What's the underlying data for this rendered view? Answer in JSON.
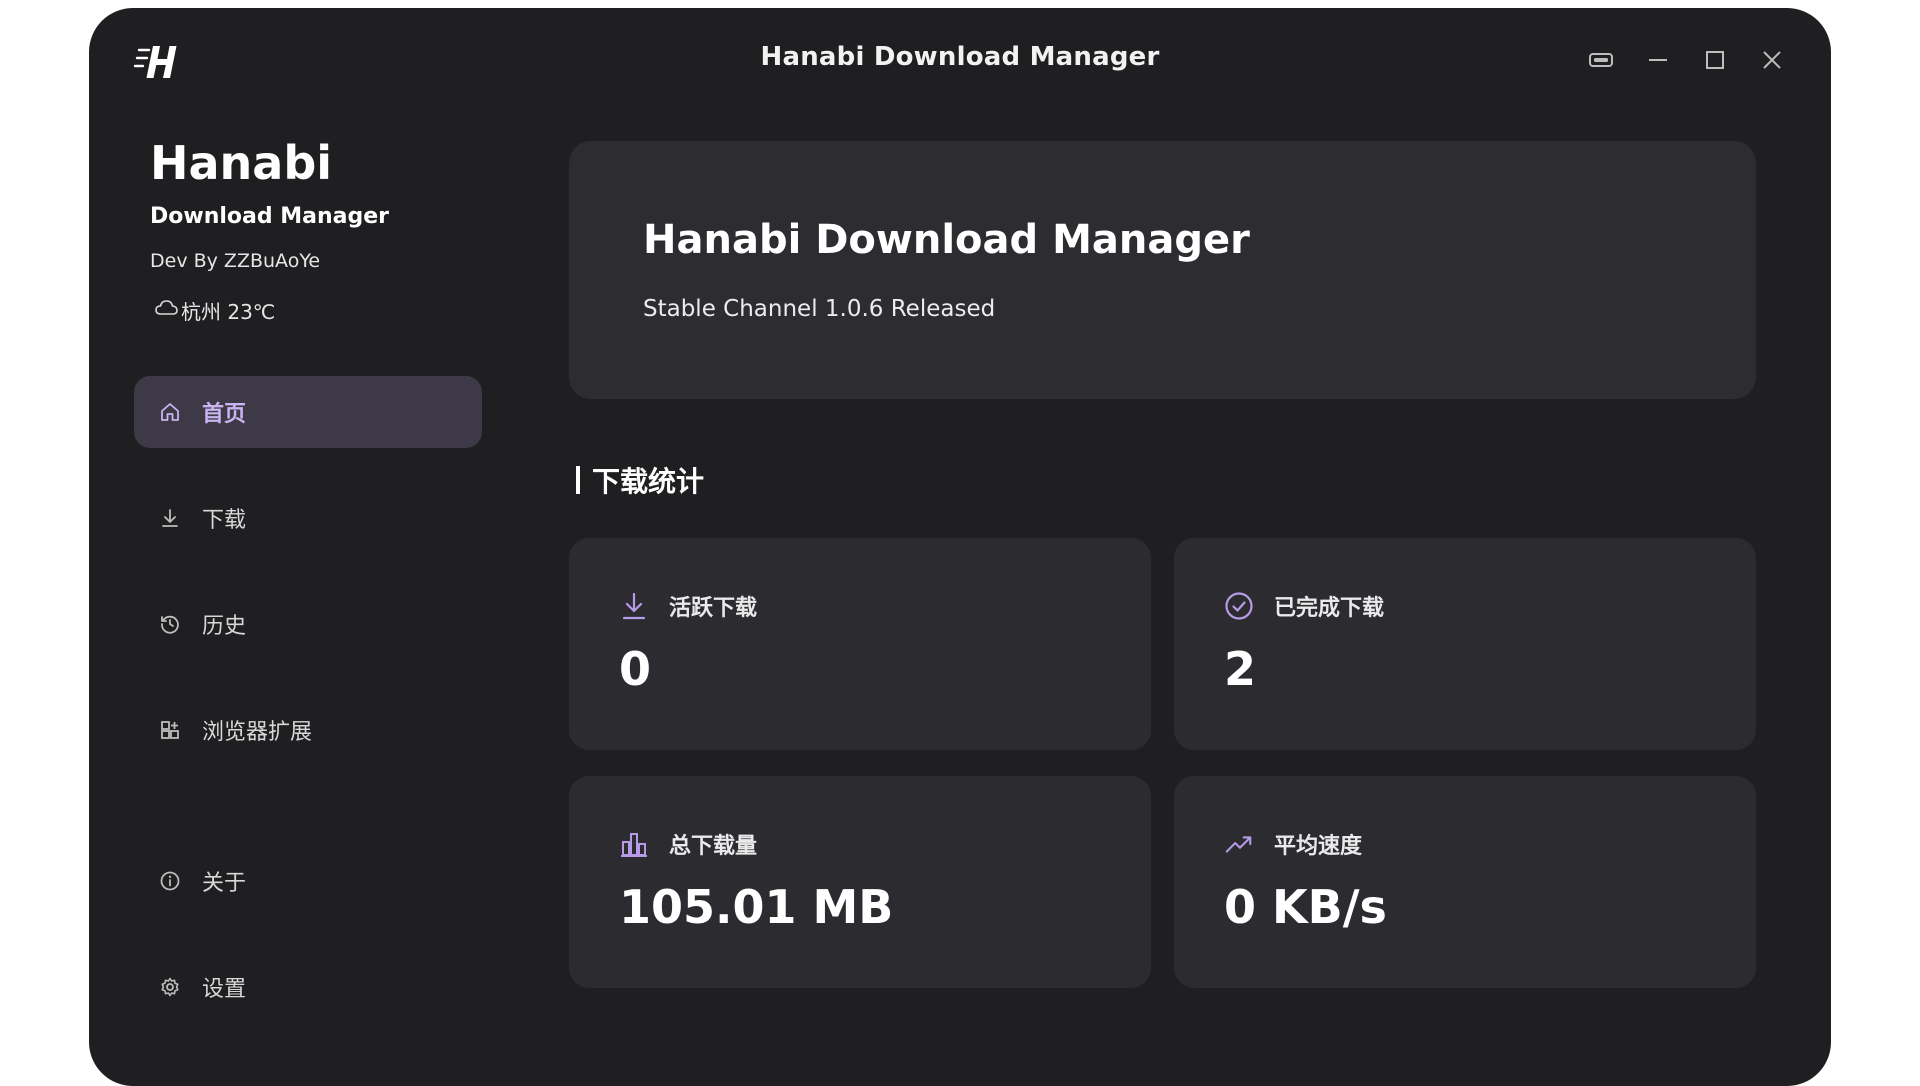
{
  "window": {
    "title": "Hanabi Download Manager"
  },
  "sidebar": {
    "brand_name": "Hanabi",
    "brand_sub": "Download Manager",
    "dev": "Dev By ZZBuAoYe",
    "weather": "杭州 23℃",
    "items": [
      {
        "label": "首页",
        "icon": "home-icon",
        "active": true
      },
      {
        "label": "下载",
        "icon": "download-icon",
        "active": false
      },
      {
        "label": "历史",
        "icon": "history-icon",
        "active": false
      },
      {
        "label": "浏览器扩展",
        "icon": "extension-icon",
        "active": false
      },
      {
        "label": "关于",
        "icon": "info-icon",
        "active": false
      },
      {
        "label": "设置",
        "icon": "gear-icon",
        "active": false
      }
    ]
  },
  "banner": {
    "title": "Hanabi Download Manager",
    "subtitle": "Stable Channel 1.0.6 Released"
  },
  "stats": {
    "section_title": "下载统计",
    "cards": [
      {
        "label": "活跃下载",
        "value": "0",
        "icon": "download-icon"
      },
      {
        "label": "已完成下载",
        "value": "2",
        "icon": "check-circle-icon"
      },
      {
        "label": "总下载量",
        "value": "105.01 MB",
        "icon": "bar-chart-icon"
      },
      {
        "label": "平均速度",
        "value": "0 KB/s",
        "icon": "trending-up-icon"
      }
    ]
  },
  "colors": {
    "window_bg": "#1f1f22",
    "card_bg": "#2b2b30",
    "active_nav_bg": "#3e3947",
    "accent": "#c9b3f0"
  }
}
